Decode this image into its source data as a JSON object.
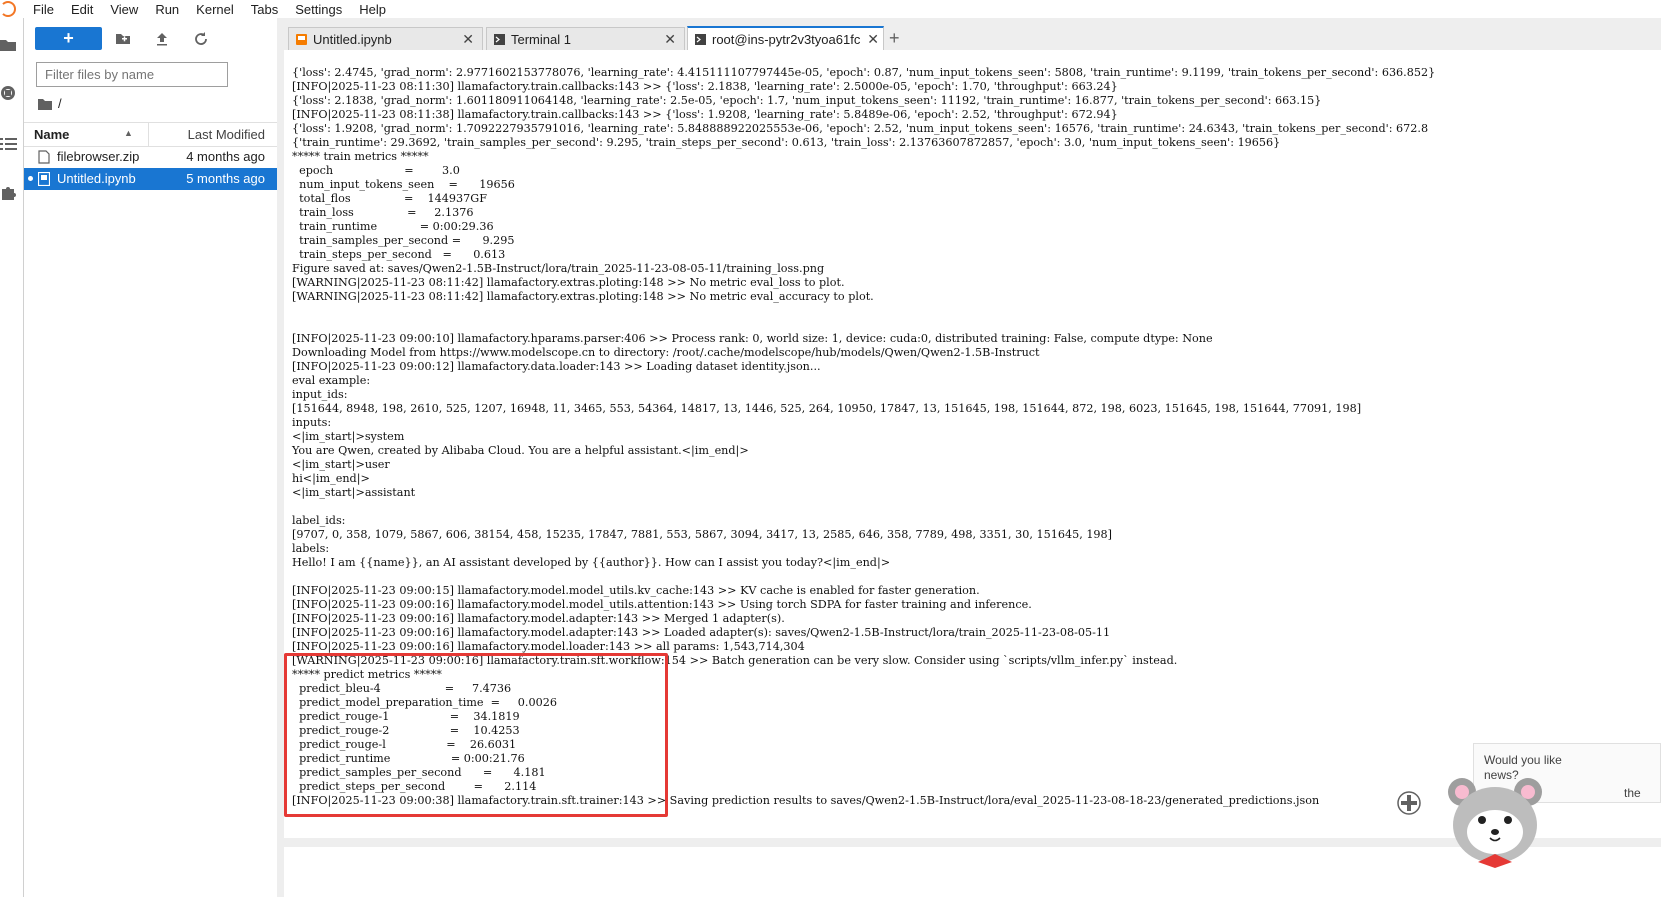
{
  "menubar": {
    "items": [
      "File",
      "Edit",
      "View",
      "Run",
      "Kernel",
      "Tabs",
      "Settings",
      "Help"
    ]
  },
  "filebrowser": {
    "new_label": "+",
    "filter_placeholder": "Filter files by name",
    "breadcrumb": "/",
    "col_name": "Name",
    "col_modified": "Last Modified",
    "files": [
      {
        "name": "filebrowser.zip",
        "modified": "4 months ago",
        "selected": false
      },
      {
        "name": "Untitled.ipynb",
        "modified": "5 months ago",
        "selected": true
      }
    ]
  },
  "tabs": [
    {
      "label": "Untitled.ipynb",
      "icon": "notebook-icon",
      "active": false
    },
    {
      "label": "Terminal 1",
      "icon": "terminal-icon",
      "active": false
    },
    {
      "label": "root@ins-pytr2v3tyoa61fc",
      "icon": "terminal-icon",
      "active": true
    }
  ],
  "terminal": {
    "text": "{'loss': 2.4745, 'grad_norm': 2.9771602153778076, 'learning_rate': 4.415111107797445e-05, 'epoch': 0.87, 'num_input_tokens_seen': 5808, 'train_runtime': 9.1199, 'train_tokens_per_second': 636.852}\n[INFO|2025-11-23 08:11:30] llamafactory.train.callbacks:143 >> {'loss': 2.1838, 'learning_rate': 2.5000e-05, 'epoch': 1.70, 'throughput': 663.24}\n{'loss': 2.1838, 'grad_norm': 1.601180911064148, 'learning_rate': 2.5e-05, 'epoch': 1.7, 'num_input_tokens_seen': 11192, 'train_runtime': 16.877, 'train_tokens_per_second': 663.15}\n[INFO|2025-11-23 08:11:38] llamafactory.train.callbacks:143 >> {'loss': 1.9208, 'learning_rate': 5.8489e-06, 'epoch': 2.52, 'throughput': 672.94}\n{'loss': 1.9208, 'grad_norm': 1.7092227935791016, 'learning_rate': 5.848888922025553e-06, 'epoch': 2.52, 'num_input_tokens_seen': 16576, 'train_runtime': 24.6343, 'train_tokens_per_second': 672.8\n{'train_runtime': 29.3692, 'train_samples_per_second': 9.295, 'train_steps_per_second': 0.613, 'train_loss': 2.13763607872857, 'epoch': 3.0, 'num_input_tokens_seen': 19656}\n***** train metrics *****\n  epoch                    =        3.0\n  num_input_tokens_seen    =      19656\n  total_flos               =    144937GF\n  train_loss               =     2.1376\n  train_runtime            = 0:00:29.36\n  train_samples_per_second =      9.295\n  train_steps_per_second   =      0.613\nFigure saved at: saves/Qwen2-1.5B-Instruct/lora/train_2025-11-23-08-05-11/training_loss.png\n[WARNING|2025-11-23 08:11:42] llamafactory.extras.ploting:148 >> No metric eval_loss to plot.\n[WARNING|2025-11-23 08:11:42] llamafactory.extras.ploting:148 >> No metric eval_accuracy to plot.\n\n\n[INFO|2025-11-23 09:00:10] llamafactory.hparams.parser:406 >> Process rank: 0, world size: 1, device: cuda:0, distributed training: False, compute dtype: None\nDownloading Model from https://www.modelscope.cn to directory: /root/.cache/modelscope/hub/models/Qwen/Qwen2-1.5B-Instruct\n[INFO|2025-11-23 09:00:12] llamafactory.data.loader:143 >> Loading dataset identity.json...\neval example:\ninput_ids:\n[151644, 8948, 198, 2610, 525, 1207, 16948, 11, 3465, 553, 54364, 14817, 13, 1446, 525, 264, 10950, 17847, 13, 151645, 198, 151644, 872, 198, 6023, 151645, 198, 151644, 77091, 198]\ninputs:\n<|im_start|>system\nYou are Qwen, created by Alibaba Cloud. You are a helpful assistant.<|im_end|>\n<|im_start|>user\nhi<|im_end|>\n<|im_start|>assistant\n\nlabel_ids:\n[9707, 0, 358, 1079, 5867, 606, 38154, 458, 15235, 17847, 7881, 553, 5867, 3094, 3417, 13, 2585, 646, 358, 7789, 498, 3351, 30, 151645, 198]\nlabels:\nHello! I am {{name}}, an AI assistant developed by {{author}}. How can I assist you today?<|im_end|>\n\n[INFO|2025-11-23 09:00:15] llamafactory.model.model_utils.kv_cache:143 >> KV cache is enabled for faster generation.\n[INFO|2025-11-23 09:00:16] llamafactory.model.model_utils.attention:143 >> Using torch SDPA for faster training and inference.\n[INFO|2025-11-23 09:00:16] llamafactory.model.adapter:143 >> Merged 1 adapter(s).\n[INFO|2025-11-23 09:00:16] llamafactory.model.adapter:143 >> Loaded adapter(s): saves/Qwen2-1.5B-Instruct/lora/train_2025-11-23-08-05-11\n[INFO|2025-11-23 09:00:16] llamafactory.model.loader:143 >> all params: 1,543,714,304\n[WARNING|2025-11-23 09:00:16] llamafactory.train.sft.workflow:154 >> Batch generation can be very slow. Consider using `scripts/vllm_infer.py` instead.\n***** predict metrics *****\n  predict_bleu-4                  =     7.4736\n  predict_model_preparation_time  =     0.0026\n  predict_rouge-1                 =    34.1819\n  predict_rouge-2                 =    10.4253\n  predict_rouge-l                 =    26.6031\n  predict_runtime                 = 0:00:21.76\n  predict_samples_per_second      =      4.181\n  predict_steps_per_second        =      2.114\n[INFO|2025-11-23 09:00:38] llamafactory.train.sft.trainer:143 >> Saving prediction results to saves/Qwen2-1.5B-Instruct/lora/eval_2025-11-23-08-18-23/generated_predictions.json"
  },
  "notification": {
    "text": "Would you like news?",
    "cut": "the"
  },
  "colors": {
    "accent": "#1976d2",
    "highlight": "#e53935",
    "jupyter_orange": "#f37726"
  }
}
